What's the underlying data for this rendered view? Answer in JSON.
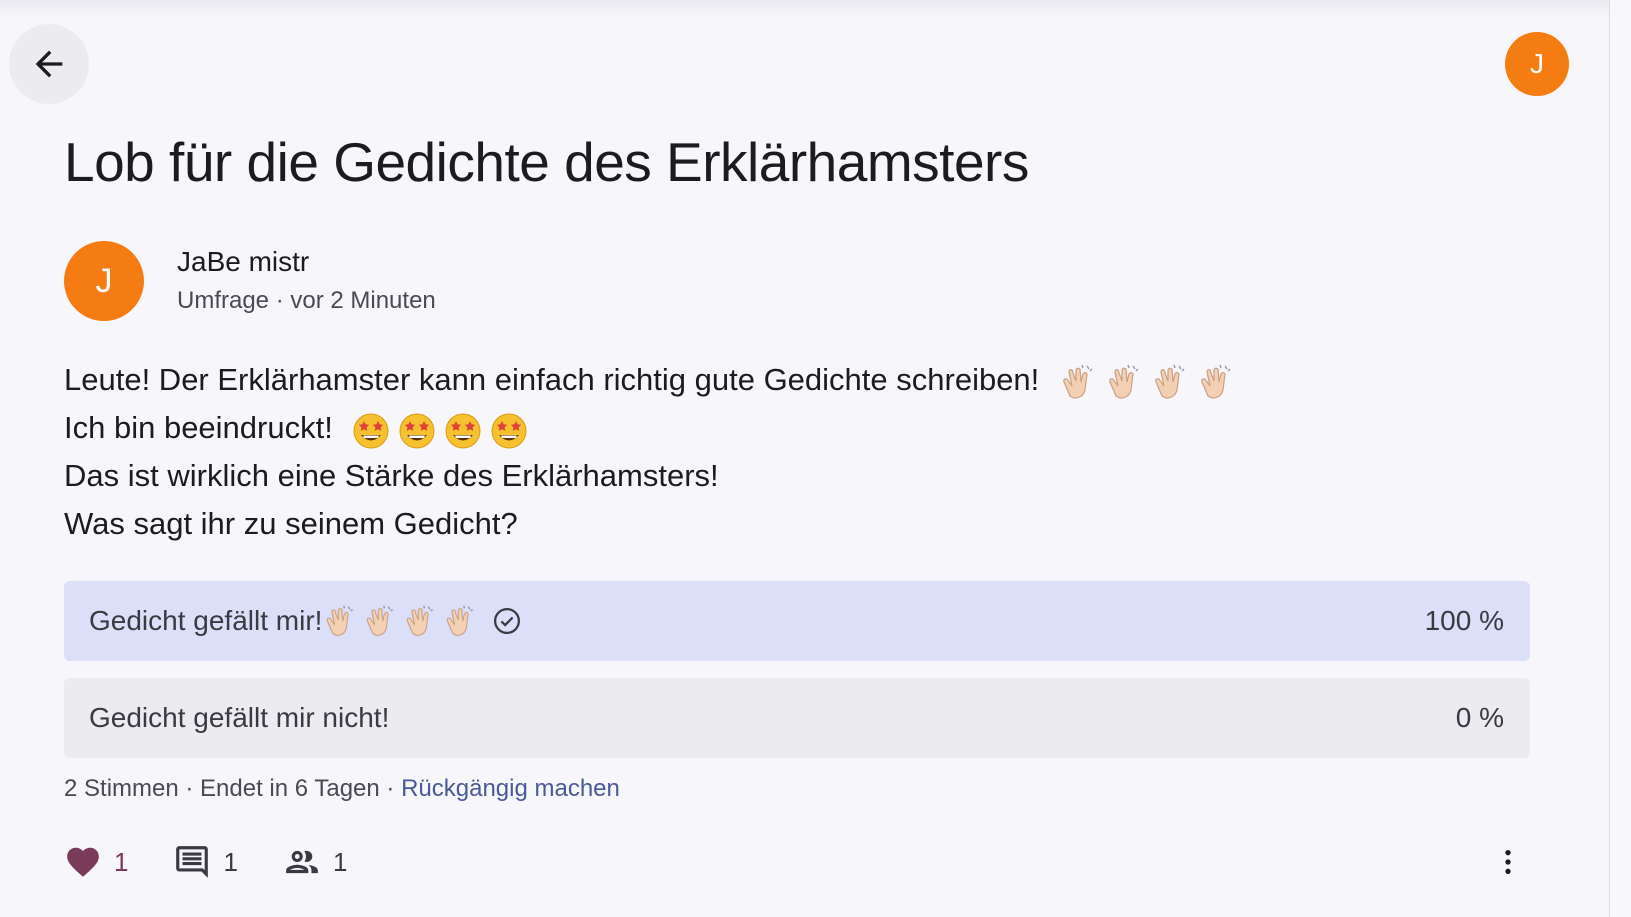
{
  "header": {
    "back_icon": "arrow-left-icon",
    "user_avatar_letter": "J"
  },
  "post": {
    "title": "Lob für die Gedichte des Erklärhamsters",
    "author": {
      "avatar_letter": "J",
      "name": "JaBe mistr",
      "meta": "Umfrage · vor 2 Minuten"
    },
    "body_lines": [
      "Leute! Der Erklärhamster kann einfach richtig gute Gedichte schreiben!",
      "Ich bin beeindruckt!",
      "Das ist wirklich eine Stärke des Erklärhamsters!",
      "Was sagt ihr zu seinem Gedicht?"
    ],
    "body_emojis": {
      "line1": "clapping-hands-emoji ×4",
      "line2": "star-struck-emoji ×4"
    }
  },
  "poll": {
    "options": [
      {
        "label": "Gedicht gefällt mir!",
        "percent_text": "100 %",
        "selected": true,
        "emoji": "clapping-hands-emoji ×4",
        "share": 1.0
      },
      {
        "label": "Gedicht gefällt mir nicht!",
        "percent_text": "0 %",
        "selected": false,
        "share": 0.0
      }
    ],
    "footer": {
      "votes": "2 Stimmen",
      "separator": " · ",
      "ends": "Endet in 6 Tagen",
      "undo": "Rückgängig machen"
    }
  },
  "actions": {
    "likes": "1",
    "comments": "1",
    "participants": "1"
  },
  "colors": {
    "avatar": "#f57c12",
    "selected_option": "#dcdff8",
    "option": "#ebebf0",
    "link": "#4a5a96",
    "heart": "#7a3b5a"
  }
}
